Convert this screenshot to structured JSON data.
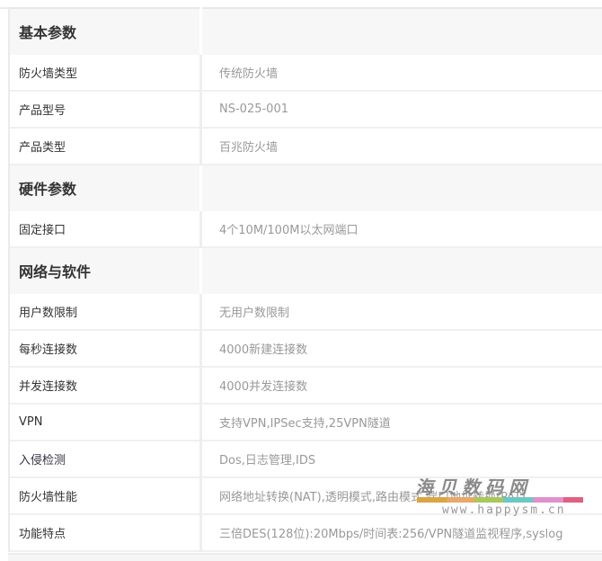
{
  "sections": [
    {
      "title": "基本参数",
      "rows": [
        {
          "label": "防火墙类型",
          "value": "传统防火墙"
        },
        {
          "label": "产品型号",
          "value": "NS-025-001"
        },
        {
          "label": "产品类型",
          "value": "百兆防火墙"
        }
      ]
    },
    {
      "title": "硬件参数",
      "rows": [
        {
          "label": "固定接口",
          "value": "4个10M/100M以太网端口"
        }
      ]
    },
    {
      "title": "网络与软件",
      "rows": [
        {
          "label": "用户数限制",
          "value": "无用户数限制"
        },
        {
          "label": "每秒连接数",
          "value": "4000新建连接数"
        },
        {
          "label": "并发连接数",
          "value": "4000并发连接数"
        },
        {
          "label": "VPN",
          "value": "支持VPN,IPSec支持,25VPN隧道"
        },
        {
          "label": "入侵检测",
          "value": "Dos,日志管理,IDS"
        },
        {
          "label": "防火墙性能",
          "value": "网络地址转换(NAT),透明模式,路由模式,端口地址转换(PAT)"
        },
        {
          "label": "功能特点",
          "value": "三倍DES(128位):20Mbps/时间表:256/VPN隧道监视程序,syslog"
        }
      ]
    }
  ],
  "watermark": {
    "logo": "海贝数码网",
    "url": "www.happysm.cn"
  }
}
